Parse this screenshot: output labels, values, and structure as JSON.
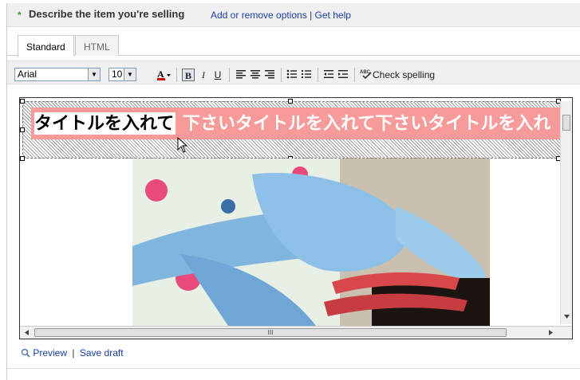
{
  "header": {
    "required_mark": "*",
    "title": "Describe the item you're selling",
    "link_options": "Add or remove options",
    "separator": "|",
    "link_help": "Get help"
  },
  "tabs": [
    {
      "label": "Standard",
      "active": true
    },
    {
      "label": "HTML",
      "active": false
    }
  ],
  "toolbar": {
    "font_family": "Arial",
    "font_size": "10",
    "bold": "B",
    "italic": "I",
    "underline": "U",
    "check_spelling": "Check spelling",
    "icons": [
      "font-color-icon",
      "align-left-icon",
      "align-center-icon",
      "align-right-icon",
      "bullet-list-icon",
      "numbered-list-icon",
      "outdent-icon",
      "indent-icon",
      "spell-check-icon"
    ]
  },
  "editor": {
    "selected_text": "タイトルを入れて",
    "rest_text": "下さいタイトルを入れて下さいタイトルを入れ",
    "title_bar_color": "#f79a9a"
  },
  "footer": {
    "preview": "Preview",
    "separator": "|",
    "save_draft": "Save draft"
  }
}
